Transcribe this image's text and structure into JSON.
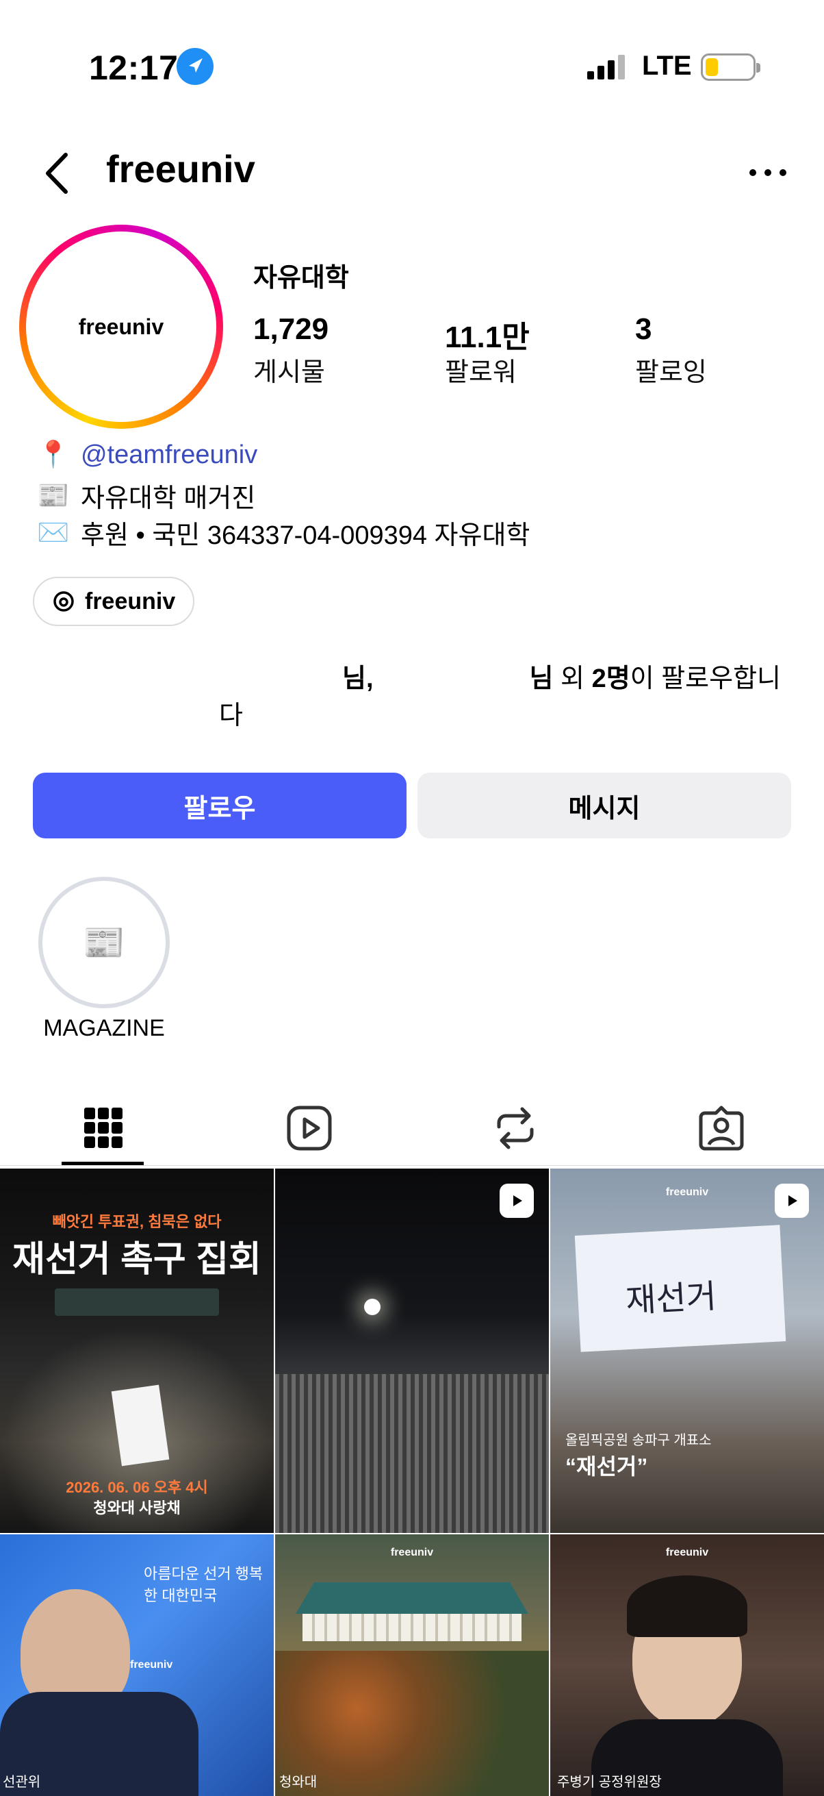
{
  "status_bar": {
    "time": "12:17",
    "network": "LTE"
  },
  "header": {
    "username": "freeuniv"
  },
  "profile": {
    "avatar_text": "freeuniv",
    "full_name": "자유대학",
    "stats": [
      {
        "value": "1,729",
        "label": "게시물"
      },
      {
        "value": "11.1만",
        "label": "팔로워"
      },
      {
        "value": "3",
        "label": "팔로잉"
      }
    ],
    "bio": {
      "line1_emoji": "📍",
      "line1_mention": "@teamfreeuniv",
      "line2_emoji": "📰",
      "line2_text": "자유대학 매거진",
      "line3_emoji": "✉️",
      "line3_text": "후원 • 국민 364337-04-009394 자유대학"
    },
    "threads_link": "freeuniv",
    "followed_by": {
      "part1": "님,",
      "part2": "님",
      "part3": " 외 ",
      "count": "2명",
      "part4": "이 팔로우합니다"
    }
  },
  "actions": {
    "follow": "팔로우",
    "message": "메시지"
  },
  "highlights": [
    {
      "label": "MAGAZINE",
      "emoji": "📰"
    }
  ],
  "tabs": [
    "grid-icon",
    "reels-icon",
    "reposts-icon",
    "tagged-icon"
  ],
  "posts": [
    {
      "top_text": "빼앗긴 투표권, 침묵은 없다",
      "title": "재선거 촉구 집회",
      "date": "2026. 06. 06 오후 4시",
      "place": "청와대 사랑채"
    },
    {
      "type": "reel"
    },
    {
      "type": "reel",
      "brand": "freeuniv",
      "sign": "재선거",
      "caption_small": "올림픽공원 송파구 개표소",
      "caption_big": "“재선거”"
    },
    {
      "brand": "freeuniv",
      "caption": "선관위",
      "banner": "아름다운 선거 행복한 대한민국"
    },
    {
      "brand": "freeuniv",
      "caption": "청와대"
    },
    {
      "brand": "freeuniv",
      "caption": "주병기 공정위원장"
    }
  ],
  "colors": {
    "primary": "#4a5df9",
    "mention": "#3a4bbd",
    "secondary_btn": "#efeff2"
  }
}
